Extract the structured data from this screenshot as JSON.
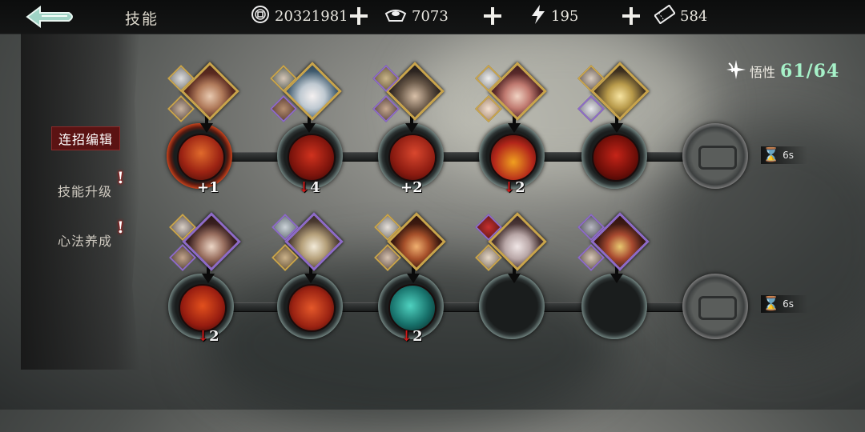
{
  "header": {
    "title": "技能",
    "currencies": [
      {
        "icon": "coin-icon",
        "value": "20321981"
      },
      {
        "icon": "silver-ingot-icon",
        "value": "7073"
      },
      {
        "icon": "energy-bolt-icon",
        "value": "195"
      },
      {
        "icon": "ticket-icon",
        "value": "584"
      }
    ]
  },
  "sidebar": {
    "items": [
      {
        "label": "连招编辑",
        "active": true,
        "alert": false
      },
      {
        "label": "技能升级",
        "active": false,
        "alert": true
      },
      {
        "label": "心法养成",
        "active": false,
        "alert": true
      }
    ],
    "alert_mark": "!"
  },
  "insight": {
    "label": "悟性",
    "value": "61/64"
  },
  "rows": [
    {
      "nodes": [
        {
          "mod": "+1",
          "mod_dir": "up",
          "portrait": "gold"
        },
        {
          "mod": "4",
          "mod_dir": "down",
          "portrait": "gold"
        },
        {
          "mod": "+2",
          "mod_dir": "up",
          "portrait": "gold"
        },
        {
          "mod": "2",
          "mod_dir": "down",
          "portrait": "gold"
        },
        {
          "mod": "",
          "mod_dir": "",
          "portrait": "gold"
        }
      ],
      "timer": "6s"
    },
    {
      "nodes": [
        {
          "mod": "2",
          "mod_dir": "down",
          "portrait": "purple"
        },
        {
          "mod": "",
          "mod_dir": "",
          "portrait": "purple"
        },
        {
          "mod": "2",
          "mod_dir": "down",
          "portrait": "gold"
        },
        {
          "mod": "",
          "mod_dir": "",
          "portrait": "gold"
        },
        {
          "mod": "",
          "mod_dir": "",
          "portrait": "purple"
        }
      ],
      "timer": "6s"
    }
  ],
  "colors": {
    "accent_red": "#5b1313",
    "insight_green": "#a6f1c8",
    "gold_frame": "#c9a44a",
    "purple_frame": "#8d6ac7"
  }
}
